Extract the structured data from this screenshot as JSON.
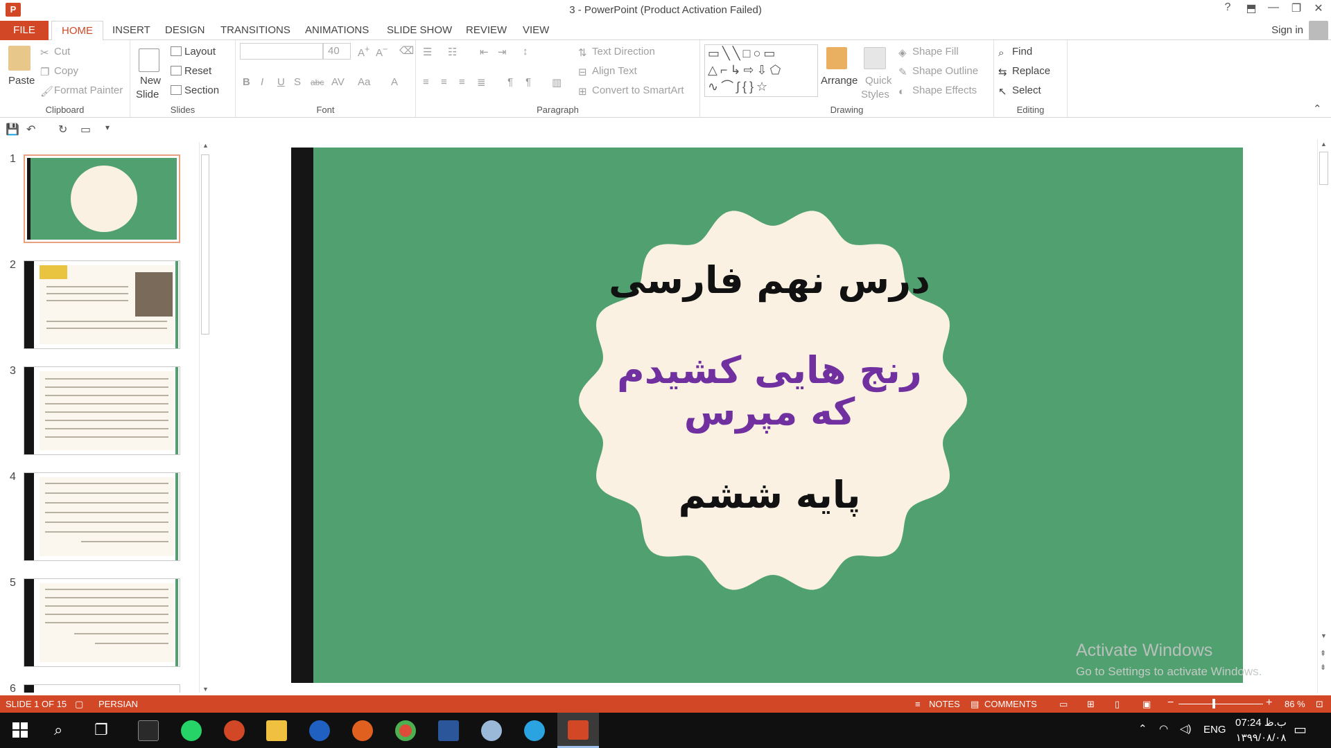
{
  "window": {
    "title": "3 - PowerPoint (Product Activation Failed)",
    "app_icon": "P"
  },
  "window_controls": {
    "help": "?",
    "ribbon_display": "⬒",
    "minimize": "—",
    "restore": "❐",
    "close": "✕"
  },
  "tabs": [
    {
      "label": "FILE"
    },
    {
      "label": "HOME"
    },
    {
      "label": "INSERT"
    },
    {
      "label": "DESIGN"
    },
    {
      "label": "TRANSITIONS"
    },
    {
      "label": "ANIMATIONS"
    },
    {
      "label": "SLIDE SHOW"
    },
    {
      "label": "REVIEW"
    },
    {
      "label": "VIEW"
    }
  ],
  "account": {
    "signin": "Sign in"
  },
  "ribbon": {
    "clipboard": {
      "label": "Clipboard",
      "paste": "Paste",
      "cut": "Cut",
      "copy": "Copy",
      "format_painter": "Format Painter"
    },
    "slides": {
      "label": "Slides",
      "new_slide_1": "New",
      "new_slide_2": "Slide",
      "layout": "Layout",
      "reset": "Reset",
      "section": "Section"
    },
    "font": {
      "label": "Font",
      "font_name": "",
      "font_size": "40",
      "bold": "B",
      "italic": "I",
      "underline": "U",
      "shadow": "S",
      "strike": "abc",
      "spacing": "AV",
      "case": "Aa",
      "color": "A"
    },
    "paragraph": {
      "label": "Paragraph",
      "text_direction": "Text Direction",
      "align_text": "Align Text",
      "convert_smartart": "Convert to SmartArt"
    },
    "drawing": {
      "label": "Drawing",
      "arrange": "Arrange",
      "quick_styles_1": "Quick",
      "quick_styles_2": "Styles",
      "shape_fill": "Shape Fill",
      "shape_outline": "Shape Outline",
      "shape_effects": "Shape Effects"
    },
    "editing": {
      "label": "Editing",
      "find": "Find",
      "replace": "Replace",
      "select": "Select"
    }
  },
  "thumbnails": [
    {
      "num": "1",
      "selected": true
    },
    {
      "num": "2"
    },
    {
      "num": "3"
    },
    {
      "num": "4"
    },
    {
      "num": "5"
    },
    {
      "num": "6"
    }
  ],
  "slide": {
    "line1": "درس نهم فارسی",
    "line2": "رنج هایی کشیدم",
    "line3": "که مپرس",
    "line4": "پایه ششم",
    "colors": {
      "background": "#50a16f",
      "badge": "#faf1e2",
      "accent_text": "#7030a0",
      "dark_text": "#111111"
    }
  },
  "watermark": {
    "line1": "Activate Windows",
    "line2": "Go to Settings to activate Windows."
  },
  "statusbar": {
    "slide_info": "SLIDE 1 OF 15",
    "language": "PERSIAN",
    "notes": "NOTES",
    "comments": "COMMENTS",
    "zoom": "86 %",
    "minus": "−",
    "plus": "+"
  },
  "taskbar": {
    "lang": "ENG",
    "time": "07:24 ب.ظ",
    "date": "۱۳۹۹/۰۸/۰۸",
    "apps": [
      "start-icon",
      "search-icon",
      "task-view-icon",
      "calculator-icon",
      "whatsapp-icon",
      "paint-icon",
      "file-explorer-icon",
      "edge-icon",
      "firefox-icon",
      "chrome-icon",
      "word-icon",
      "paint3d-icon",
      "telegram-icon",
      "powerpoint-icon"
    ]
  }
}
